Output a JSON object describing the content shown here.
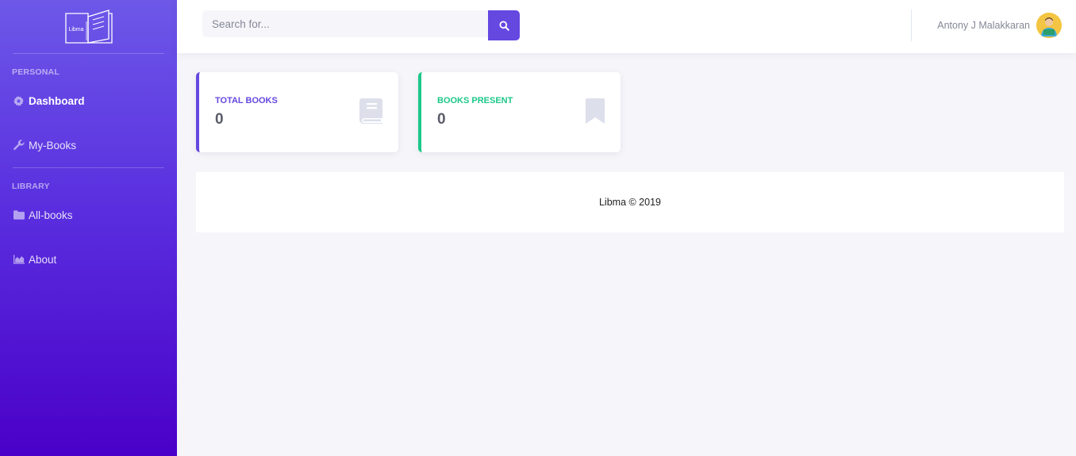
{
  "brand": {
    "logo_text": "Libma"
  },
  "sidebar": {
    "sections": [
      {
        "heading": "Personal"
      },
      {
        "heading": "Library"
      }
    ],
    "items": [
      {
        "label": "Dashboard",
        "icon": "gear-icon",
        "active": true
      },
      {
        "label": "My-Books",
        "icon": "wrench-icon",
        "active": false
      },
      {
        "label": "All-books",
        "icon": "folder-icon",
        "active": false
      },
      {
        "label": "About",
        "icon": "chart-area-icon",
        "active": false
      }
    ]
  },
  "topbar": {
    "search_placeholder": "Search for...",
    "user_name": "Antony J Malakkaran"
  },
  "cards": [
    {
      "label": "Total Books",
      "value": "0",
      "accent": "#6448e0",
      "icon": "book-icon"
    },
    {
      "label": "Books Present",
      "value": "0",
      "accent": "#1cc88a",
      "icon": "bookmark-icon"
    }
  ],
  "footer": {
    "text": "Libma © 2019"
  },
  "colors": {
    "primary": "#6448e0",
    "success": "#1cc88a",
    "sidebar_top": "#6d58e8",
    "sidebar_bottom": "#4a00c8"
  }
}
